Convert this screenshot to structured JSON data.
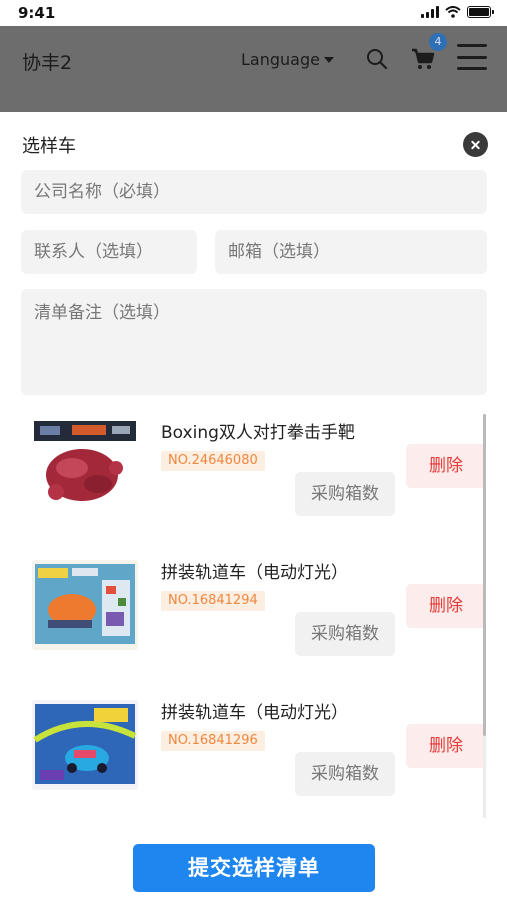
{
  "status_bar": {
    "time": "9:41"
  },
  "header": {
    "brand": "协丰2",
    "language_label": "Language",
    "cart_count": "4",
    "icons": [
      "search-icon",
      "cart-icon",
      "menu-icon"
    ]
  },
  "sheet": {
    "title": "选样车",
    "form": {
      "company_placeholder": "公司名称（必填）",
      "contact_placeholder": "联系人（选填）",
      "email_placeholder": "邮箱（选填）",
      "notes_placeholder": "清单备注（选填）"
    },
    "items": [
      {
        "name": "Boxing双人对打拳击手靶",
        "number": "NO.24646080",
        "qty_label": "采购箱数",
        "delete_label": "删除"
      },
      {
        "name": "拼装轨道车（电动灯光）",
        "number": "NO.16841294",
        "qty_label": "采购箱数",
        "delete_label": "删除"
      },
      {
        "name": "拼装轨道车（电动灯光）",
        "number": "NO.16841296",
        "qty_label": "采购箱数",
        "delete_label": "删除"
      }
    ],
    "submit_label": "提交选样清单"
  },
  "colors": {
    "accent": "#1f86f0",
    "delete_text": "#e53935",
    "number_tag_text": "#f0873d",
    "overlay_header": "#6d6d6d"
  }
}
